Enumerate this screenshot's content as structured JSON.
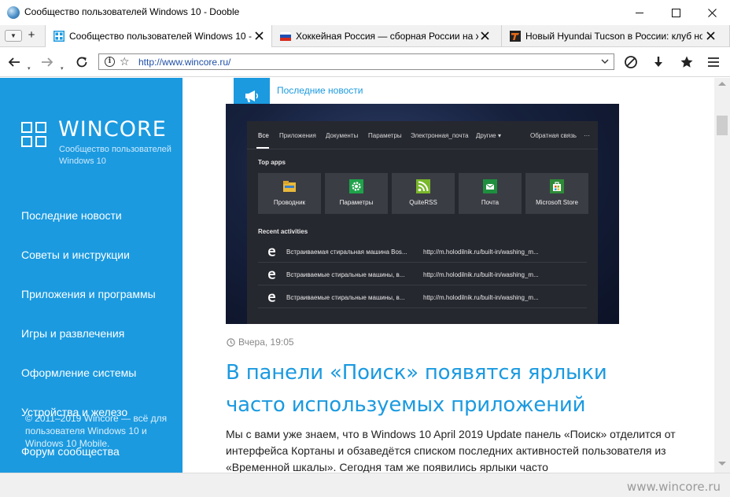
{
  "window": {
    "title": "Сообщество пользователей Windows 10 - Dooble"
  },
  "tabs": [
    {
      "label": "Сообщество пользователей Windows 10 -...",
      "favicon": "wincore-favicon",
      "active": true
    },
    {
      "label": "Хоккейная Россия — сборная России на х...",
      "favicon": "russia-flag-favicon",
      "active": false
    },
    {
      "label": "Новый Hyundai Tucson в России: клуб нов...",
      "favicon": "t-logo-favicon",
      "active": false
    }
  ],
  "toolbar": {
    "url": "http://www.wincore.ru/"
  },
  "sidebar": {
    "logo_name": "WINCORE",
    "logo_sub": "Сообщество пользователей Windows 10",
    "nav": [
      "Последние новости",
      "Советы и инструкции",
      "Приложения и программы",
      "Игры и развлечения",
      "Оформление системы",
      "Устройства и железо",
      "Форум сообщества"
    ],
    "copyright": "© 2011–2019 Wincore — всё для пользователя Windows 10 и Windows 10 Mobile."
  },
  "content": {
    "section_link": "Последние новости",
    "screenshot": {
      "tabs": [
        "Все",
        "Приложения",
        "Документы",
        "Параметры",
        "Электронная_почта",
        "Другие",
        "Обратная связь",
        "···"
      ],
      "top_apps_heading": "Top apps",
      "apps": [
        {
          "name": "Проводник",
          "color": "#e9b93b"
        },
        {
          "name": "Параметры",
          "color": "#1fa34a"
        },
        {
          "name": "QuiteRSS",
          "color": "#7ab72b"
        },
        {
          "name": "Почта",
          "color": "#1e8f3e"
        },
        {
          "name": "Microsoft Store",
          "color": "#2e8b37"
        }
      ],
      "recent_heading": "Recent activities",
      "recent": [
        {
          "title": "Встраиваемая стиральная машина Bos...",
          "url": "http://m.holodilnik.ru/built-in/washing_m..."
        },
        {
          "title": "Встраиваемые стиральные машины, в...",
          "url": "http://m.holodilnik.ru/built-in/washing_m..."
        },
        {
          "title": "Встраиваемые стиральные машины, в...",
          "url": "http://m.holodilnik.ru/built-in/washing_m..."
        }
      ]
    },
    "post_time": "Вчера, 19:05",
    "post_title": "В панели «Поиск» появятся ярлыки часто используемых приложений",
    "post_body": "Мы с вами уже знаем, что в Windows 10 April 2019 Update панель «Поиск» отделится от интерфейса Кортаны и обзаведётся списком последних активностей пользователя из «Временной шкалы». Сегодня там же появились ярлыки часто"
  },
  "watermark": "www.wincore.ru",
  "colors": {
    "accent": "#1b9ae0"
  }
}
